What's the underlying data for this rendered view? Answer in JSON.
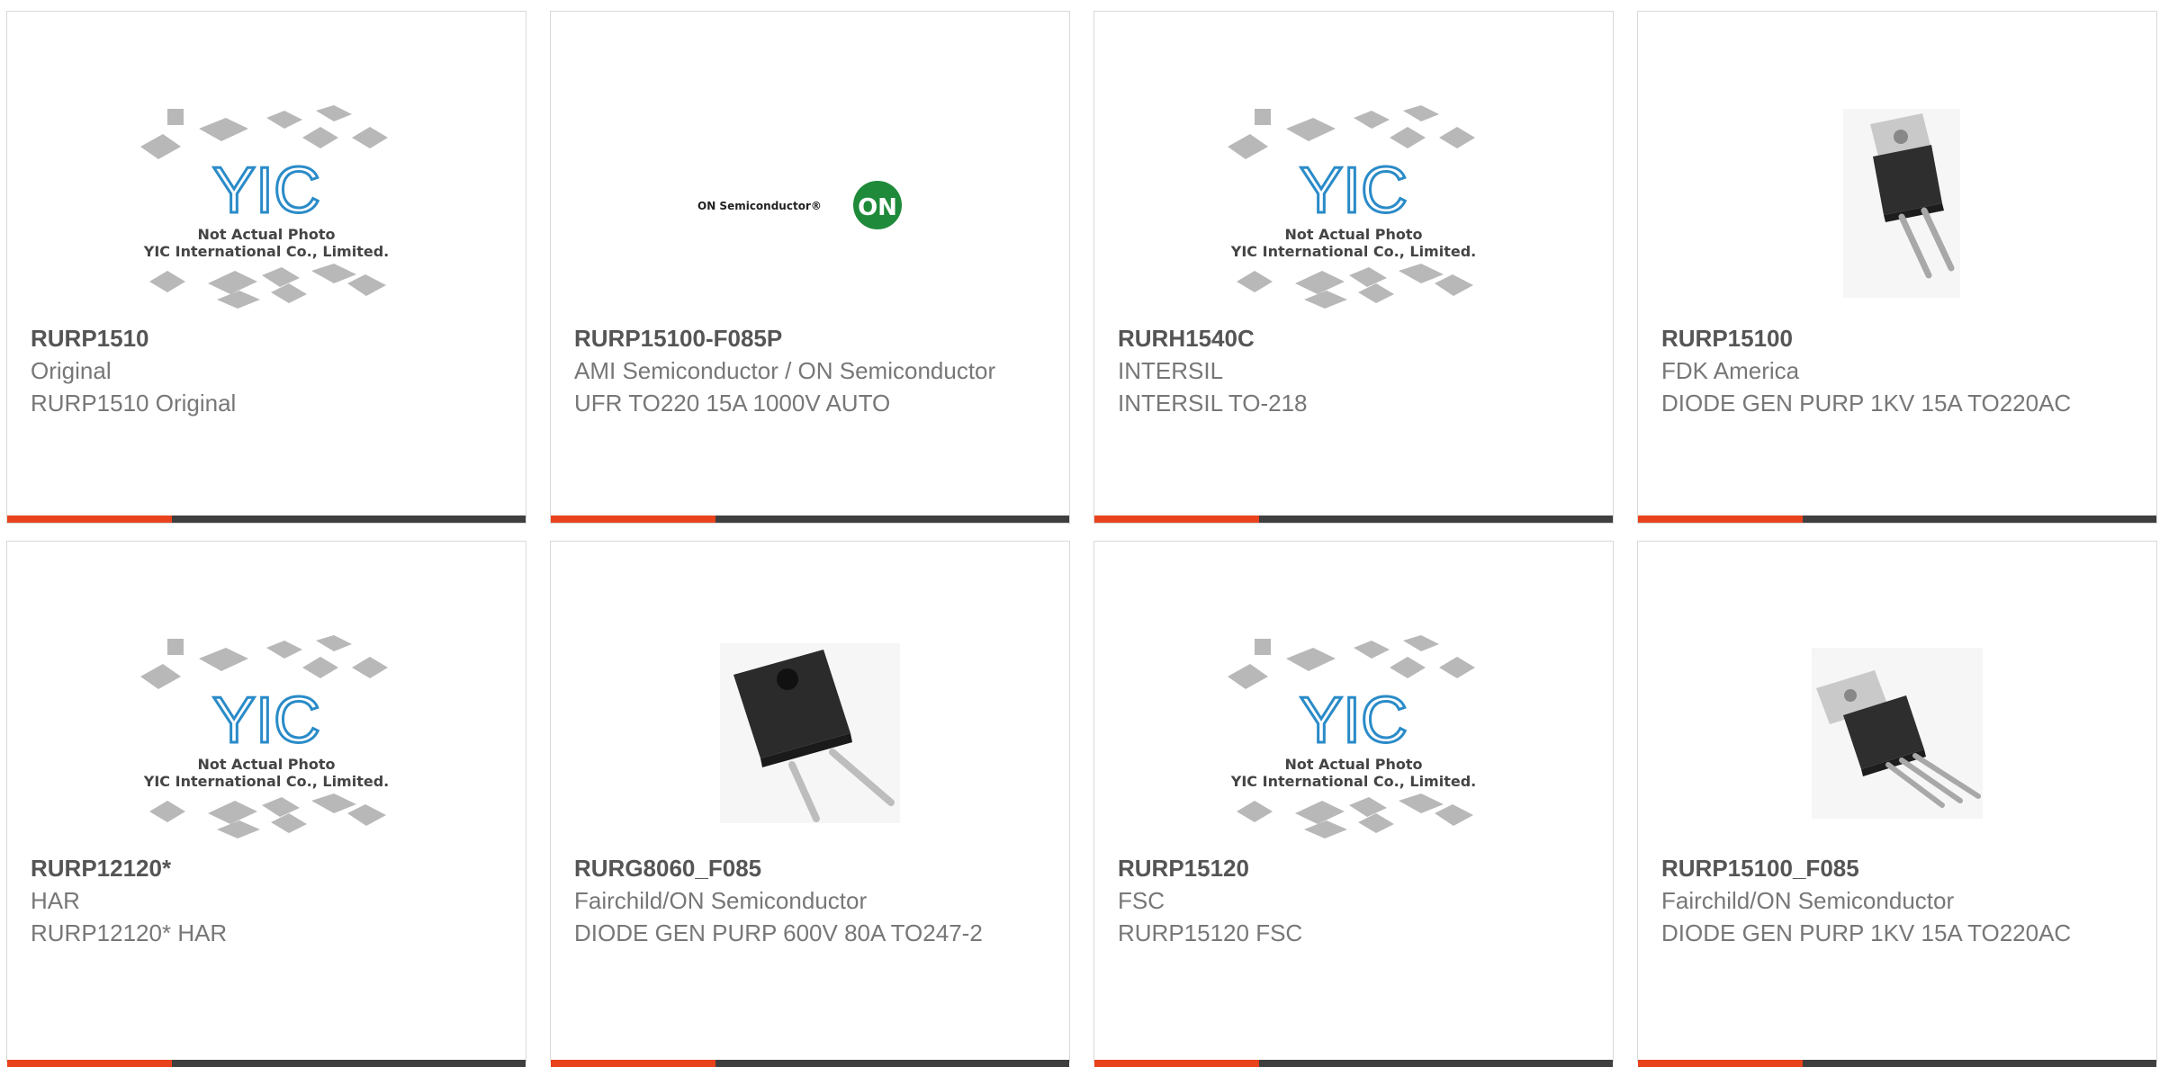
{
  "products": [
    {
      "part": "RURP1510",
      "manufacturer": "Original",
      "description": "RURP1510 Original",
      "image": "yic-placeholder"
    },
    {
      "part": "RURP15100-F085P",
      "manufacturer": "AMI Semiconductor / ON Semiconductor",
      "description": "UFR TO220 15A 1000V AUTO",
      "image": "on-semi-logo"
    },
    {
      "part": "RURH1540C",
      "manufacturer": "INTERSIL",
      "description": "INTERSIL TO-218",
      "image": "yic-placeholder"
    },
    {
      "part": "RURP15100",
      "manufacturer": "FDK America",
      "description": "DIODE GEN PURP 1KV 15A TO220AC",
      "image": "to220-2lead"
    },
    {
      "part": "RURP12120*",
      "manufacturer": "HAR",
      "description": "RURP12120* HAR",
      "image": "yic-placeholder"
    },
    {
      "part": "RURG8060_F085",
      "manufacturer": "Fairchild/ON Semiconductor",
      "description": "DIODE GEN PURP 600V 80A TO247-2",
      "image": "to247-2lead"
    },
    {
      "part": "RURP15120",
      "manufacturer": "FSC",
      "description": "RURP15120 FSC",
      "image": "yic-placeholder"
    },
    {
      "part": "RURP15100_F085",
      "manufacturer": "Fairchild/ON Semiconductor",
      "description": "DIODE GEN PURP 1KV 15A TO220AC",
      "image": "to220-3lead"
    }
  ],
  "placeholder": {
    "logo_text": "YIC",
    "line1": "Not Actual Photo",
    "line2": "YIC International Co., Limited."
  },
  "on_logo": {
    "wordmark": "ON Semiconductor®",
    "badge": "ON"
  },
  "colors": {
    "accent": "#e8431d",
    "bar": "#3f3f3f",
    "border": "#d9d9d9",
    "part_text": "#555555",
    "body_text": "#777777",
    "yic_blue": "#2a8bc8",
    "on_green": "#1f8a3a"
  }
}
